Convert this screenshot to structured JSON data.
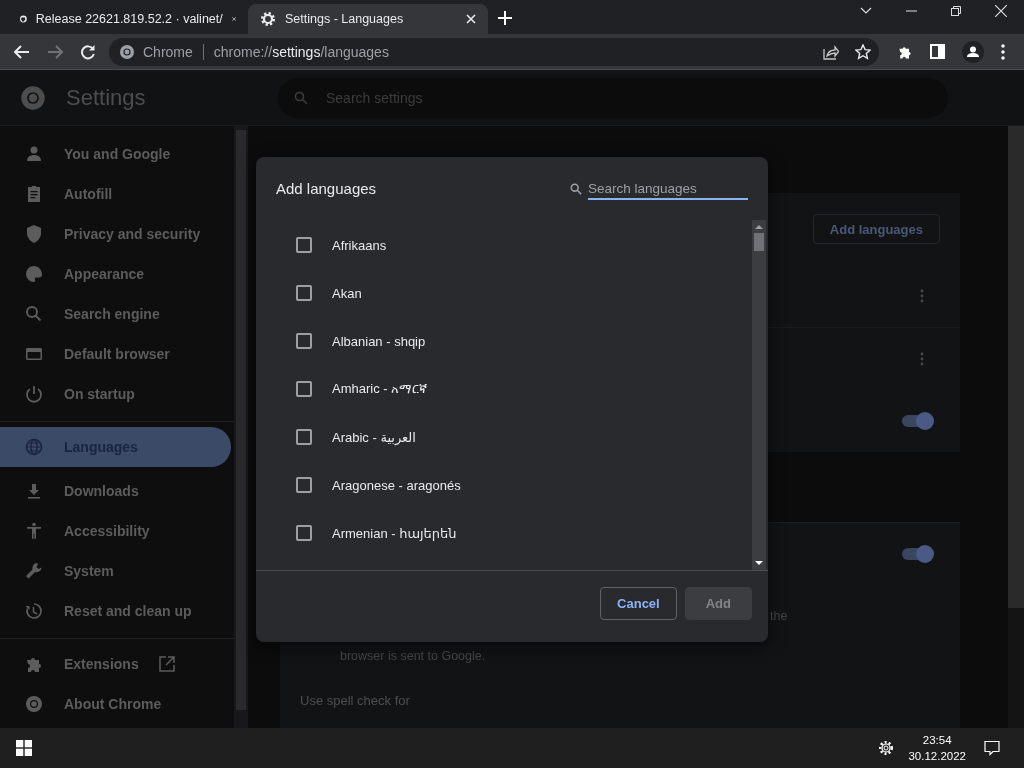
{
  "tabs": [
    {
      "title": "Release 22621.819.52.2 · valinet/",
      "selected": false
    },
    {
      "title": "Settings - Languages",
      "selected": true
    }
  ],
  "address": {
    "site": "Chrome",
    "scheme": "chrome://",
    "host": "settings",
    "path": "/languages"
  },
  "settings": {
    "title": "Settings",
    "search_placeholder": "Search settings"
  },
  "sidebar": {
    "sections": [
      {
        "items": [
          {
            "label": "You and Google",
            "selected": false,
            "external": false
          },
          {
            "label": "Autofill",
            "selected": false,
            "external": false
          },
          {
            "label": "Privacy and security",
            "selected": false,
            "external": false
          },
          {
            "label": "Appearance",
            "selected": false,
            "external": false
          },
          {
            "label": "Search engine",
            "selected": false,
            "external": false
          },
          {
            "label": "Default browser",
            "selected": false,
            "external": false
          },
          {
            "label": "On startup",
            "selected": false,
            "external": false
          }
        ]
      },
      {
        "items": [
          {
            "label": "Languages",
            "selected": true,
            "external": false
          },
          {
            "label": "Downloads",
            "selected": false,
            "external": false
          },
          {
            "label": "Accessibility",
            "selected": false,
            "external": false
          },
          {
            "label": "System",
            "selected": false,
            "external": false
          },
          {
            "label": "Reset and clean up",
            "selected": false,
            "external": false
          }
        ]
      },
      {
        "items": [
          {
            "label": "Extensions",
            "selected": false,
            "external": true
          },
          {
            "label": "About Chrome",
            "selected": false,
            "external": false
          }
        ]
      }
    ]
  },
  "page": {
    "add_languages_button": "Add languages",
    "toggles": [
      {
        "on": true
      },
      {
        "on": true
      }
    ],
    "text_fragment": "the",
    "caption": "browser is sent to Google.",
    "spell_check_label": "Use spell check for"
  },
  "dialog": {
    "title": "Add languages",
    "search_placeholder": "Search languages",
    "languages": [
      {
        "label": "Afrikaans",
        "checked": false
      },
      {
        "label": "Akan",
        "checked": false
      },
      {
        "label": "Albanian - shqip",
        "checked": false
      },
      {
        "label": "Amharic - አማርኛ",
        "checked": false
      },
      {
        "label": "Arabic - العربية",
        "checked": false
      },
      {
        "label": "Aragonese - aragonés",
        "checked": false
      },
      {
        "label": "Armenian - հայերեն",
        "checked": false
      }
    ],
    "buttons": [
      {
        "label": "Cancel",
        "kind": "secondary",
        "disabled": false
      },
      {
        "label": "Add",
        "kind": "primary",
        "disabled": true
      }
    ]
  },
  "taskbar": {
    "time": "23:54",
    "date": "30.12.2022"
  }
}
